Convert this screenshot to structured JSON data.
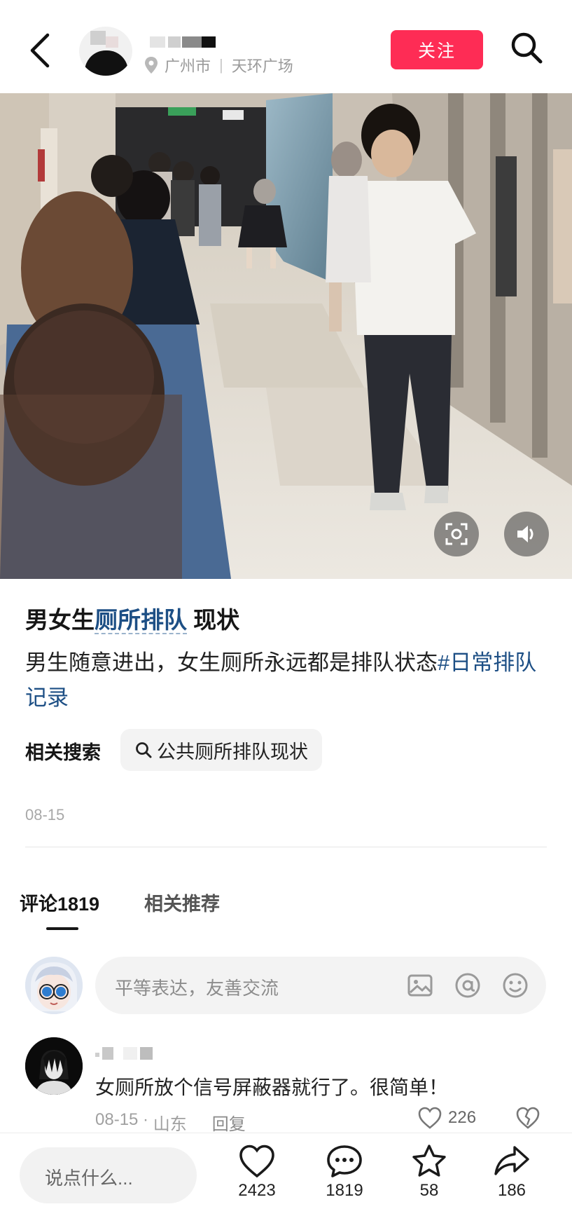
{
  "header": {
    "location_city": "广州市",
    "location_place": "天环广场",
    "follow_label": "关注"
  },
  "post": {
    "title_prefix": "男女生",
    "title_highlight": "厕所排队",
    "title_suffix": " 现状",
    "description": "男生随意进出，女生厕所永远都是排队状态",
    "hashtag": "#日常排队记录",
    "related_label": "相关搜索",
    "related_query": "公共厕所排队现状",
    "date": "08-15"
  },
  "tabs": [
    {
      "label": "评论1819"
    },
    {
      "label": "相关推荐"
    }
  ],
  "comment_input": {
    "placeholder": "平等表达，友善交流"
  },
  "comments": [
    {
      "text": "女厕所放个信号屏蔽器就行了。很简单！",
      "date": "08-15",
      "region": "山东",
      "reply_label": "回复",
      "likes": "226"
    }
  ],
  "bottom_bar": {
    "input_placeholder": "说点什么...",
    "likes": "2423",
    "comments": "1819",
    "favorites": "58",
    "shares": "186"
  },
  "colors": {
    "accent": "#fe2c55",
    "link": "#1d4f85"
  },
  "icons": [
    "back-arrow-icon",
    "location-pin-icon",
    "search-icon",
    "fullscreen-icon",
    "volume-icon",
    "image-icon",
    "at-icon",
    "emoji-icon",
    "heart-icon",
    "broken-heart-icon",
    "comment-icon",
    "star-icon",
    "share-icon"
  ]
}
